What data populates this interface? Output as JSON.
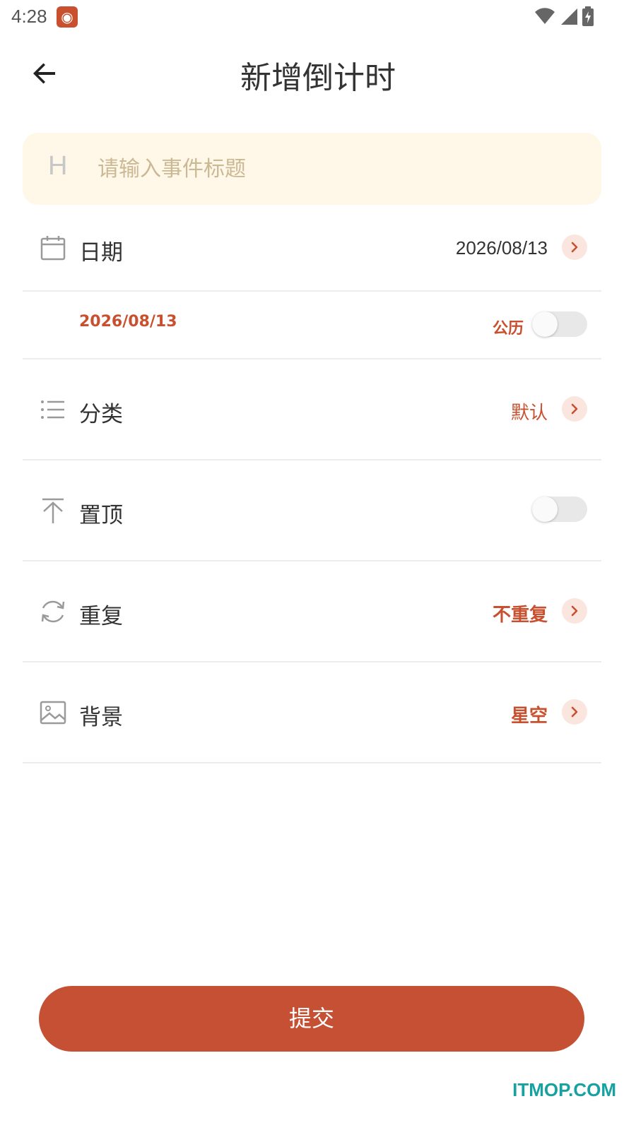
{
  "status_bar": {
    "time": "4:28",
    "app_icon": "weibo-icon"
  },
  "header": {
    "title": "新增倒计时",
    "back_icon": "arrow-left-icon"
  },
  "title_input": {
    "prefix": "H",
    "placeholder": "请输入事件标题",
    "value": ""
  },
  "date_row": {
    "label": "日期",
    "value": "2026/08/13",
    "icon": "calendar-icon"
  },
  "calendar_row": {
    "date_text": "2026/08/13",
    "calendar_type": "公历",
    "toggle_on": false
  },
  "category_row": {
    "label": "分类",
    "value": "默认",
    "icon": "list-icon"
  },
  "pin_row": {
    "label": "置顶",
    "icon": "pin-top-icon",
    "toggle_on": false
  },
  "repeat_row": {
    "label": "重复",
    "value": "不重复",
    "icon": "refresh-icon"
  },
  "background_row": {
    "label": "背景",
    "value": "星空",
    "icon": "image-icon"
  },
  "submit": {
    "label": "提交"
  },
  "watermark": "ITMOP.COM",
  "colors": {
    "accent": "#c9502f",
    "input_bg": "#fff7e8",
    "chevron_bg": "#fbe5df",
    "divider": "#ececec"
  }
}
